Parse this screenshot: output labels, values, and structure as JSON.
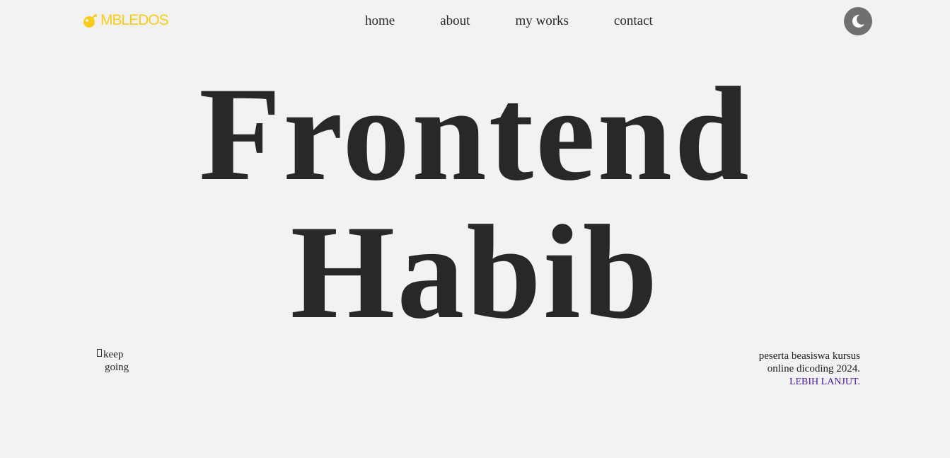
{
  "brand": {
    "name": "MBLEDOS",
    "icon": "bomb-icon",
    "color": "#f7cd1a"
  },
  "nav": {
    "items": [
      {
        "label": "home"
      },
      {
        "label": "about"
      },
      {
        "label": "my works"
      },
      {
        "label": "contact"
      }
    ]
  },
  "theme_toggle": {
    "icon": "moon-icon",
    "background": "#707070"
  },
  "hero": {
    "line1": "Frontend",
    "line2": "Habib"
  },
  "tagline": {
    "line1": "keep",
    "line2": "going"
  },
  "description": {
    "text": "peserta beasiswa kursus online dicoding 2024.",
    "link_label": "LEBIH LANJUT.",
    "link_color": "#4b1aa0"
  }
}
